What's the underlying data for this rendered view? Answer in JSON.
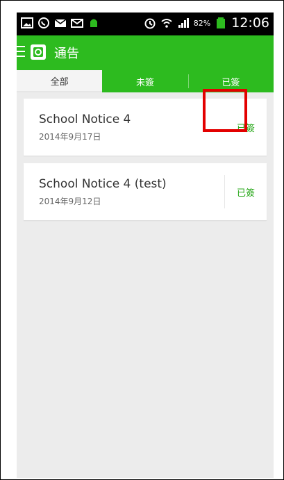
{
  "status_bar": {
    "battery_percent": "82%",
    "time": "12:06",
    "icons": [
      "image-icon",
      "whatsapp-icon",
      "mail-icon",
      "email-icon",
      "android-icon",
      "alarm-icon",
      "wifi-icon",
      "signal-icon",
      "battery-icon"
    ]
  },
  "app_bar": {
    "title": "通告"
  },
  "tabs": [
    {
      "label": "全部"
    },
    {
      "label": "未簽"
    },
    {
      "label": "已簽"
    }
  ],
  "notices": [
    {
      "title": "School Notice 4",
      "date": "2014年9月17日",
      "status": "已簽"
    },
    {
      "title": "School Notice 4 (test)",
      "date": "2014年9月12日",
      "status": "已簽"
    }
  ],
  "colors": {
    "primary_green": "#2dbb1f",
    "status_green": "#29a81b",
    "highlight_red": "#e30000"
  }
}
